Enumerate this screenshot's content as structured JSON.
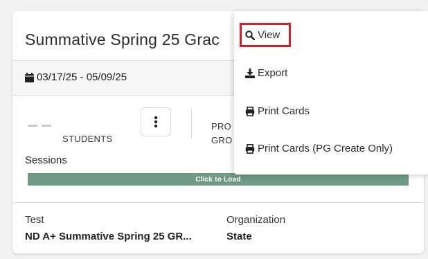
{
  "card": {
    "title": "Summative Spring 25 Grac",
    "date_range": "03/17/25 - 05/09/25",
    "students_placeholder": "— —",
    "students_label": "STUDENTS",
    "progress_label_line1": "PRO",
    "progress_label_line2": "GRO",
    "sessions_label": "Sessions",
    "load_button": "Click to Load",
    "footer": {
      "test_label": "Test",
      "test_value": "ND A+ Summative Spring 25 GR...",
      "org_label": "Organization",
      "org_value": "State"
    }
  },
  "menu": {
    "items": [
      {
        "label": "View",
        "icon": "search-icon"
      },
      {
        "label": "Export",
        "icon": "download-icon"
      },
      {
        "label": "Print Cards",
        "icon": "printer-icon"
      },
      {
        "label": "Print Cards (PG Create Only)",
        "icon": "printer-icon"
      }
    ],
    "highlight_color": "#d32030"
  },
  "colors": {
    "load_bar": "#6e9a86",
    "card_bg": "#ffffff",
    "page_bg": "#f2f2f2"
  }
}
